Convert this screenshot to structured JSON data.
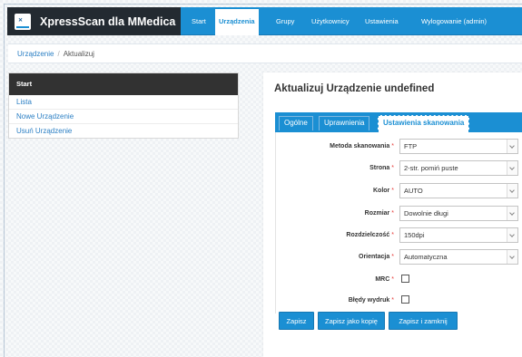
{
  "app": {
    "brand": "XpressScan dla MMedica",
    "logo_icon": "xpressscan-logo-icon"
  },
  "nav": {
    "items": [
      {
        "label": "Start",
        "active": false
      },
      {
        "label": "Urządzenia",
        "active": true
      },
      {
        "label": "Grupy",
        "active": false
      },
      {
        "label": "Użytkownicy",
        "active": false
      },
      {
        "label": "Ustawienia",
        "active": false
      },
      {
        "label": "Wylogowanie (admin)",
        "active": false
      }
    ]
  },
  "breadcrumb": {
    "parent": "Urządzenie",
    "separator": "/",
    "current": "Aktualizuj"
  },
  "sidebar": {
    "header": "Start",
    "items": [
      {
        "label": "Lista"
      },
      {
        "label": "Nowe Urządzenie"
      },
      {
        "label": "Usuń Urządzenie"
      }
    ]
  },
  "panel": {
    "title": "Aktualizuj Urządzenie undefined",
    "tabs": [
      {
        "label": "Ogólne",
        "active": false
      },
      {
        "label": "Uprawnienia",
        "active": false
      },
      {
        "label": "Ustawienia skanowania",
        "active": true
      }
    ]
  },
  "form": {
    "required_mark": "*",
    "fields": [
      {
        "label": "Metoda skanowania",
        "type": "select",
        "value": "FTP"
      },
      {
        "label": "Strona",
        "type": "select",
        "value": "2-str. pomiń puste"
      },
      {
        "label": "Kolor",
        "type": "select",
        "value": "AUTO"
      },
      {
        "label": "Rozmiar",
        "type": "select",
        "value": "Dowolnie długi"
      },
      {
        "label": "Rozdzielczość",
        "type": "select",
        "value": "150dpi"
      },
      {
        "label": "Orientacja",
        "type": "select",
        "value": "Automatyczna"
      },
      {
        "label": "MRC",
        "type": "checkbox",
        "checked": false
      },
      {
        "label": "Błędy wydruk",
        "type": "checkbox",
        "checked": false
      }
    ]
  },
  "buttons": {
    "save": "Zapisz",
    "save_copy": "Zapisz jako kopię",
    "save_close": "Zapisz i zamknij"
  },
  "colors": {
    "accent": "#1b8fd3",
    "brand_bg": "#232a31",
    "sidebar_head": "#323232",
    "required": "#e53935",
    "link": "#2b7fc4"
  }
}
